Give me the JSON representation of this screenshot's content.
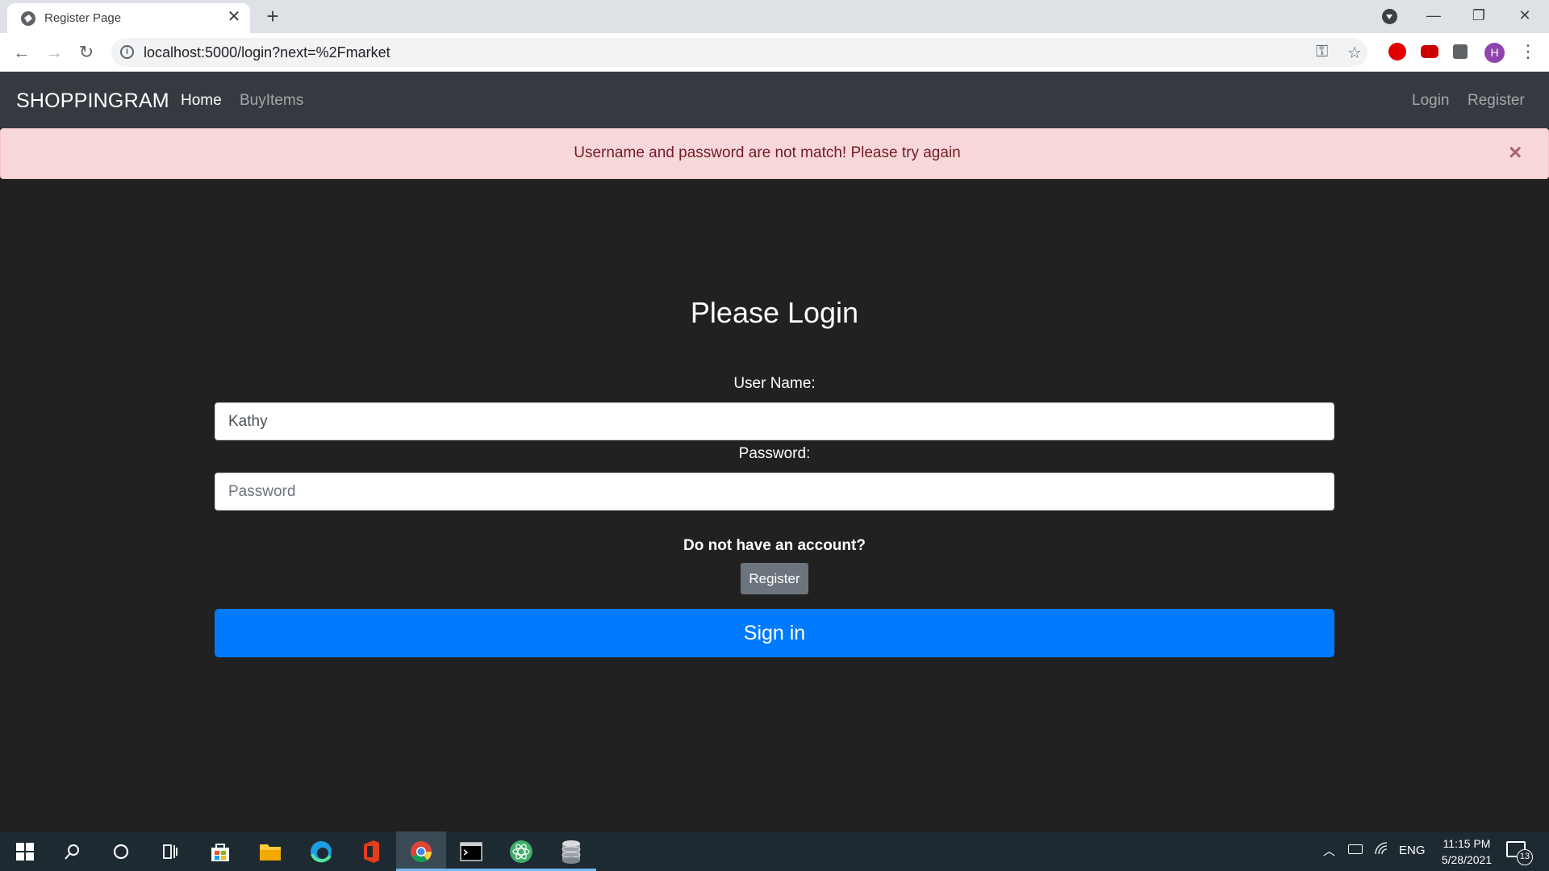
{
  "browser": {
    "tab_title": "Register Page",
    "tab_close": "✕",
    "new_tab": "+",
    "url": "localhost:5000/login?next=%2Fmarket",
    "profile_initial": "H",
    "window": {
      "minimize": "—",
      "restore": "❐",
      "close": "✕"
    }
  },
  "navbar": {
    "brand": "SHOPPINGRAM",
    "left_links": [
      "Home",
      "BuyItems"
    ],
    "right_links": [
      "Login",
      "Register"
    ]
  },
  "alert": {
    "message": "Username and password are not match! Please try again",
    "close": "×"
  },
  "form": {
    "title": "Please Login",
    "username_label": "User Name:",
    "username_value": "Kathy",
    "password_label": "Password:",
    "password_placeholder": "Password",
    "question": "Do not have an account?",
    "register_button": "Register",
    "signin_button": "Sign in"
  },
  "taskbar": {
    "language": "ENG",
    "time": "11:15 PM",
    "date": "5/28/2021",
    "notification_count": "13",
    "apps": [
      "start-icon",
      "search-icon",
      "cortana-icon",
      "task-view-icon",
      "store-icon",
      "file-explorer-icon",
      "edge-icon",
      "office-icon",
      "chrome-icon",
      "terminal-icon",
      "atom-icon",
      "database-icon"
    ]
  },
  "colors": {
    "page_bg": "#212121",
    "navbar_bg": "#343a40",
    "alert_bg": "#f8d7da",
    "alert_text": "#721c24",
    "primary": "#007bff",
    "secondary": "#6c757d"
  }
}
